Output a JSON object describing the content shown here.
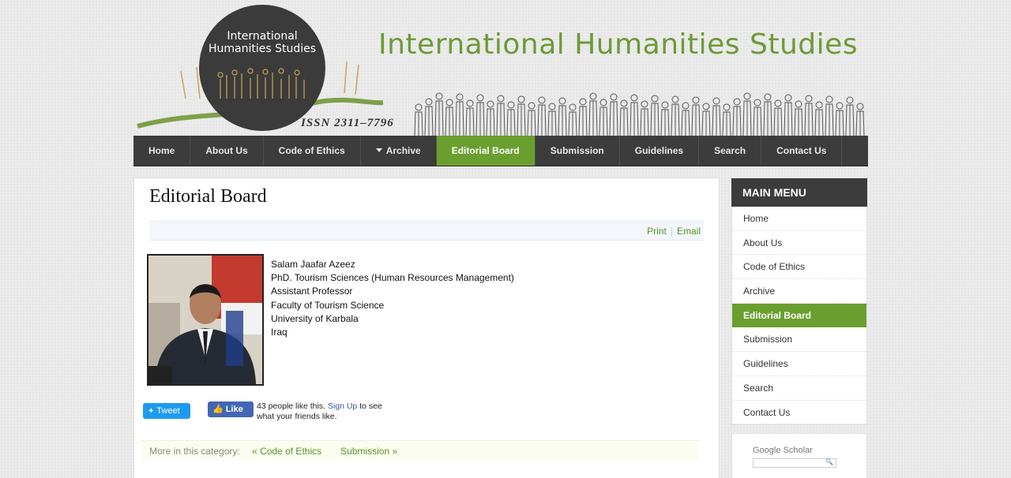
{
  "header": {
    "logo_line1": "International",
    "logo_line2": "Humanities Studies",
    "issn": "ISSN 2311–7796",
    "site_title": "International Humanities Studies"
  },
  "nav": {
    "items": [
      {
        "label": "Home"
      },
      {
        "label": "About Us"
      },
      {
        "label": "Code of Ethics"
      },
      {
        "label": "Archive"
      },
      {
        "label": "Editorial Board"
      },
      {
        "label": "Submission"
      },
      {
        "label": "Guidelines"
      },
      {
        "label": "Search"
      },
      {
        "label": "Contact Us"
      }
    ],
    "active": "Editorial Board"
  },
  "article": {
    "title": "Editorial Board",
    "tools": {
      "print": "Print",
      "email": "Email"
    },
    "bio": [
      "Salam Jaafar Azeez",
      "PhD. Tourism Sciences (Human Resources Management)",
      "Assistant Professor",
      "Faculty of Tourism Science",
      "University of Karbala",
      "Iraq"
    ]
  },
  "social": {
    "tweet": "Tweet",
    "like": "Like",
    "like_count_text": "43 people like this.",
    "signup": "Sign Up",
    "signup_suffix": "to see",
    "line2": "what your friends like."
  },
  "more": {
    "label": "More in this category:",
    "prev": "« Code of Ethics",
    "next": "Submission »"
  },
  "sidebar": {
    "heading": "MAIN MENU",
    "items": [
      {
        "label": "Home"
      },
      {
        "label": "About Us"
      },
      {
        "label": "Code of Ethics"
      },
      {
        "label": "Archive"
      },
      {
        "label": "Editorial Board"
      },
      {
        "label": "Submission"
      },
      {
        "label": "Guidelines"
      },
      {
        "label": "Search"
      },
      {
        "label": "Contact Us"
      }
    ],
    "active": "Editorial Board",
    "scholar_label": "Google Scholar"
  },
  "colors": {
    "accent": "#6a9f2f",
    "nav_bg": "#3c3c3c",
    "title_green": "#6d9a37"
  }
}
